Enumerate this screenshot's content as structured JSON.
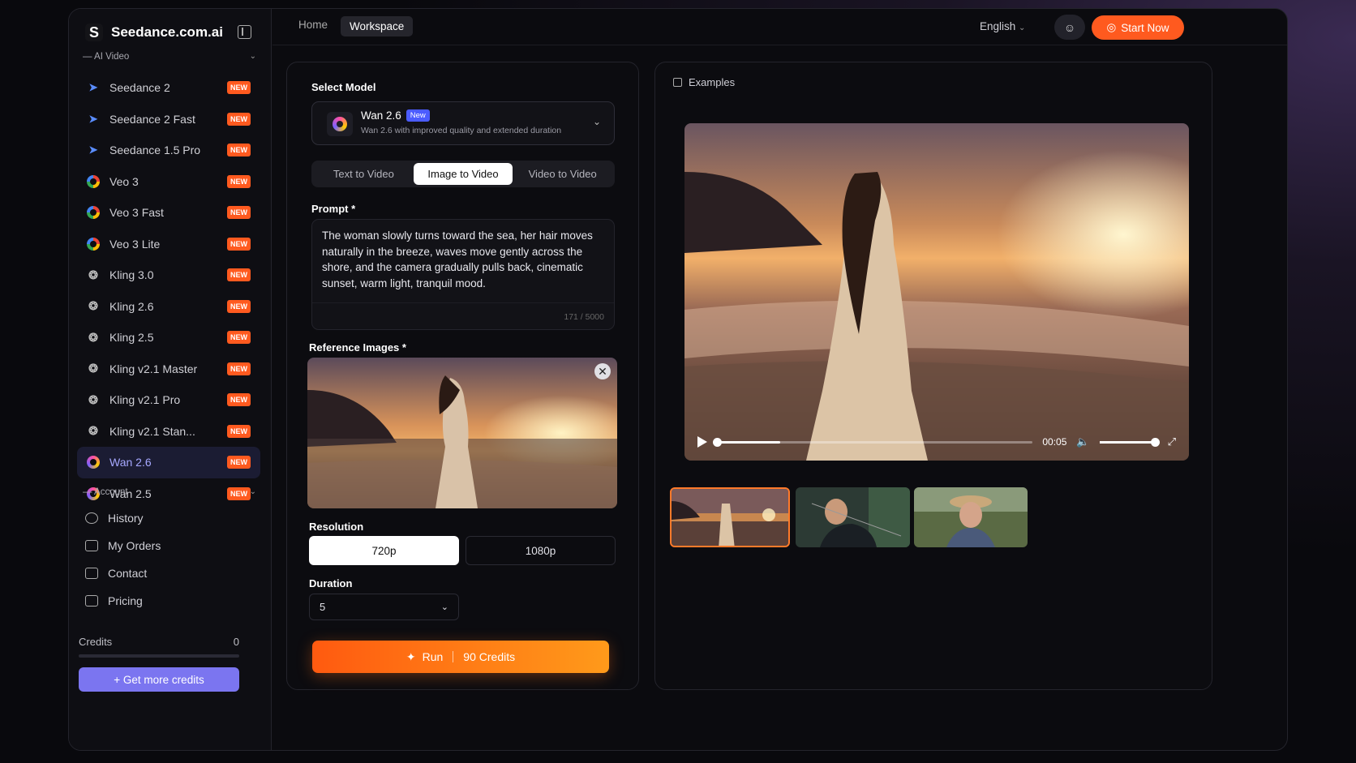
{
  "brand": {
    "name": "Seedance.com.ai",
    "logo_letter": "S"
  },
  "sidebar": {
    "section_video": "— AI Video",
    "items": [
      {
        "label": "Seedance 2",
        "badge": "NEW",
        "icon": "seedance"
      },
      {
        "label": "Seedance 2 Fast",
        "badge": "NEW",
        "icon": "seedance"
      },
      {
        "label": "Seedance 1.5 Pro",
        "badge": "NEW",
        "icon": "seedance"
      },
      {
        "label": "Veo 3",
        "badge": "NEW",
        "icon": "google"
      },
      {
        "label": "Veo 3 Fast",
        "badge": "NEW",
        "icon": "google"
      },
      {
        "label": "Veo 3 Lite",
        "badge": "NEW",
        "icon": "google"
      },
      {
        "label": "Kling 3.0",
        "badge": "NEW",
        "icon": "kling"
      },
      {
        "label": "Kling 2.6",
        "badge": "NEW",
        "icon": "kling"
      },
      {
        "label": "Kling 2.5",
        "badge": "NEW",
        "icon": "kling"
      },
      {
        "label": "Kling v2.1 Master",
        "badge": "NEW",
        "icon": "kling"
      },
      {
        "label": "Kling v2.1 Pro",
        "badge": "NEW",
        "icon": "kling"
      },
      {
        "label": "Kling v2.1 Stan...",
        "badge": "NEW",
        "icon": "kling"
      },
      {
        "label": "Wan 2.6",
        "badge": "NEW",
        "icon": "wan",
        "active": true
      },
      {
        "label": "Wan 2.5",
        "badge": "NEW",
        "icon": "wan"
      }
    ],
    "section_account": "— Account",
    "account": [
      {
        "label": "History"
      },
      {
        "label": "My Orders"
      },
      {
        "label": "Contact"
      },
      {
        "label": "Pricing"
      }
    ],
    "credits_label": "Credits",
    "credits_value": "0",
    "more_credits": "+  Get more credits"
  },
  "topbar": {
    "home": "Home",
    "workspace": "Workspace",
    "language": "English",
    "start": "Start Now"
  },
  "form": {
    "select_model_label": "Select Model",
    "model_name": "Wan 2.6",
    "model_tag": "New",
    "model_desc": "Wan 2.6 with improved quality and extended duration",
    "modes": [
      "Text to Video",
      "Image to Video",
      "Video to Video"
    ],
    "active_mode": 1,
    "prompt_label": "Prompt *",
    "prompt_text": "The woman slowly turns toward the sea, her hair moves naturally in the breeze, waves move gently across the shore, and the camera gradually pulls back, cinematic sunset, warm light, tranquil mood.",
    "prompt_count": "171 / 5000",
    "ref_label": "Reference Images *",
    "resolution_label": "Resolution",
    "resolutions": [
      "720p",
      "1080p"
    ],
    "duration_label": "Duration",
    "duration_value": "5",
    "run_label": "Run",
    "run_credits": "90 Credits"
  },
  "examples": {
    "title": "Examples",
    "time": "00:05",
    "progress": 0.2,
    "volume": 0.95
  },
  "colors": {
    "accent": "#ff5a1f",
    "active_nav": "#a6a8ff",
    "badge": "#ff5a1f",
    "credits_btn": "#7b75f0"
  }
}
